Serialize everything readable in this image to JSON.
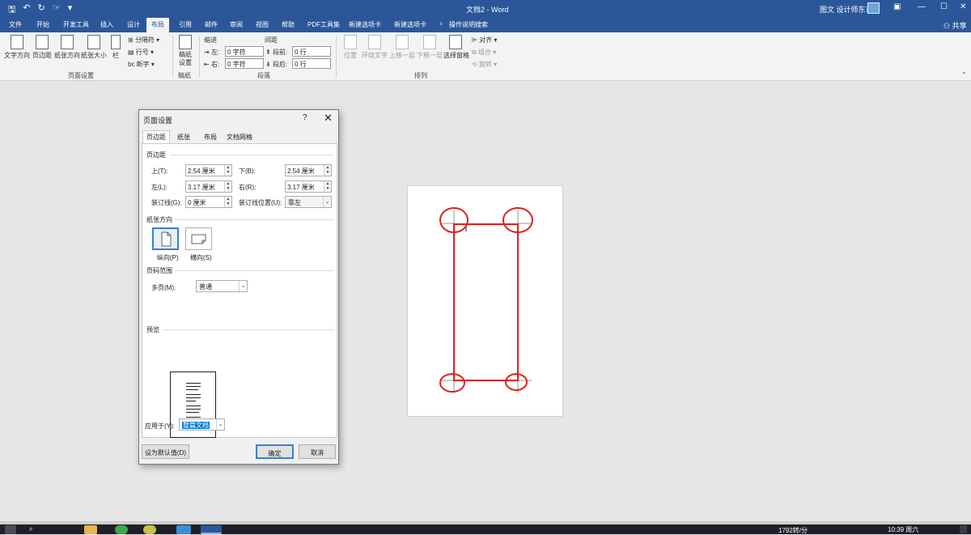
{
  "window": {
    "title": "文档2 - Word",
    "user_name": "图文 设计师东东",
    "share_label": "共享",
    "window_controls": [
      "layout",
      "minimize",
      "maximize",
      "close"
    ]
  },
  "quick_access": [
    "save-icon",
    "undo-icon",
    "redo-icon",
    "touch-mode-icon",
    "customize-icon"
  ],
  "ribbon_tabs": {
    "items": [
      "文件",
      "开始",
      "开发工具",
      "插入",
      "设计",
      "布局",
      "引用",
      "邮件",
      "审阅",
      "视图",
      "帮助",
      "PDF工具集",
      "新建选项卡",
      "新建选项卡"
    ],
    "active": "布局",
    "tell_me": "操作说明搜索"
  },
  "ribbon": {
    "page_setup": {
      "text_direction": "文字方向",
      "margins": "页边距",
      "orientation": "纸张方向",
      "size": "纸张大小",
      "columns": "栏",
      "breaks": "分隔符",
      "line_numbers": "行号",
      "hyphenation": "断字",
      "group_label": "页面设置"
    },
    "manuscript": {
      "button": "稿纸设置",
      "group_label": "稿纸"
    },
    "paragraph": {
      "indent_label": "缩进",
      "spacing_label": "间距",
      "left_label": "左:",
      "left_value": "0 字符",
      "right_label": "右:",
      "right_value": "0 字符",
      "before_label": "段前:",
      "before_value": "0 行",
      "after_label": "段后:",
      "after_value": "0 行",
      "group_label": "段落"
    },
    "arrange": {
      "position": "位置",
      "wrap_text": "环绕文字",
      "bring_forward": "上移一层",
      "send_backward": "下移一层",
      "selection_pane": "选择窗格",
      "align": "对齐",
      "group": "组合",
      "rotate": "旋转",
      "group_label": "排列"
    }
  },
  "dialog": {
    "title": "页面设置",
    "help": "?",
    "close": "✕",
    "tabs": [
      "页边距",
      "纸张",
      "布局",
      "文档网格"
    ],
    "active_tab": "页边距",
    "margins_section": "页边距",
    "top_label": "上(T):",
    "top_value": "2.54 厘米",
    "bottom_label": "下(B):",
    "bottom_value": "2.54 厘米",
    "left_label": "左(L):",
    "left_value": "3.17 厘米",
    "right_label": "右(R):",
    "right_value": "3.17 厘米",
    "gutter_label": "装订线(G):",
    "gutter_value": "0 厘米",
    "gutter_pos_label": "装订线位置(U):",
    "gutter_pos_value": "靠左",
    "orientation_section": "纸张方向",
    "portrait_label": "纵向(P)",
    "landscape_label": "横向(S)",
    "orientation_selected": "portrait",
    "pages_section": "页码范围",
    "multiple_pages_label": "多页(M):",
    "multiple_pages_value": "普通",
    "preview_section": "预览",
    "apply_to_label": "应用于(Y):",
    "apply_to_value": "整篇文档",
    "default_button": "设为默认值(D)",
    "ok_button": "确定",
    "cancel_button": "取消"
  },
  "annotation_color": "#e02020",
  "statusbar": {
    "speed": "1792转/分",
    "time": "10:39",
    "weekday": "周六"
  },
  "colors": {
    "titlebar": "#2b579a",
    "ribbon": "#f3f3f3",
    "canvas": "#e6e6e6"
  }
}
